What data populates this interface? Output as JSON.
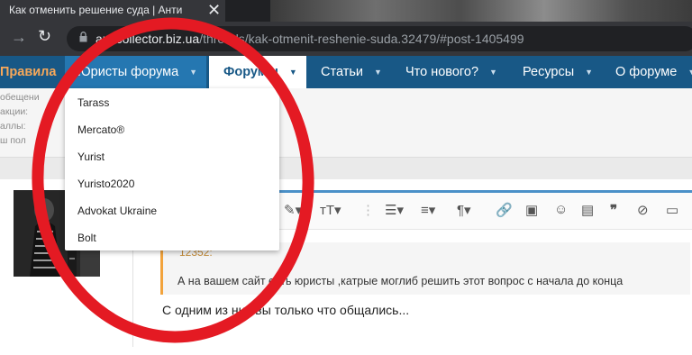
{
  "browser": {
    "tab_title": "Как отменить решение суда | Анти",
    "close_glyph": "✕",
    "url_host": "anticollector.biz.ua",
    "url_path": "/threads/kak-otmenit-reshenie-suda.32479/#post-1405499"
  },
  "navbar": {
    "items": [
      {
        "label": "Правила"
      },
      {
        "label": "Юристы форума"
      },
      {
        "label": "Форумы"
      },
      {
        "label": "Статьи"
      },
      {
        "label": "Что нового?"
      },
      {
        "label": "Ресурсы"
      },
      {
        "label": "О форуме"
      }
    ]
  },
  "stats": [
    "обещени",
    "акции:",
    "аллы:",
    "ш пол"
  ],
  "dropdown": {
    "items": [
      "Tarass",
      "Mercato®",
      "Yurist",
      "Yuristo2020",
      "Advokat Ukraine",
      "Bolt"
    ]
  },
  "post": {
    "quote_author": "12352:",
    "quote_text": "А на вашем сайт   есть юристы ,катрые моглиб решить этот вопрос с начала до конца",
    "reply_text": "С одним из них вы только что общались..."
  },
  "editor_tools": [
    "link-icon",
    "image-icon",
    "smile-icon",
    "media-icon",
    "quote-icon",
    "spoiler-icon",
    "code-icon",
    "list-icon",
    "align-icon",
    "paragraph-icon",
    "text-size-icon"
  ],
  "colors": {
    "nav_bg": "#185886",
    "nav_active": "#2577b1",
    "rules": "#f7a85a",
    "circle": "#e41a23",
    "editor_accent": "#4a90c8",
    "quote_border": "#f2a33c"
  }
}
